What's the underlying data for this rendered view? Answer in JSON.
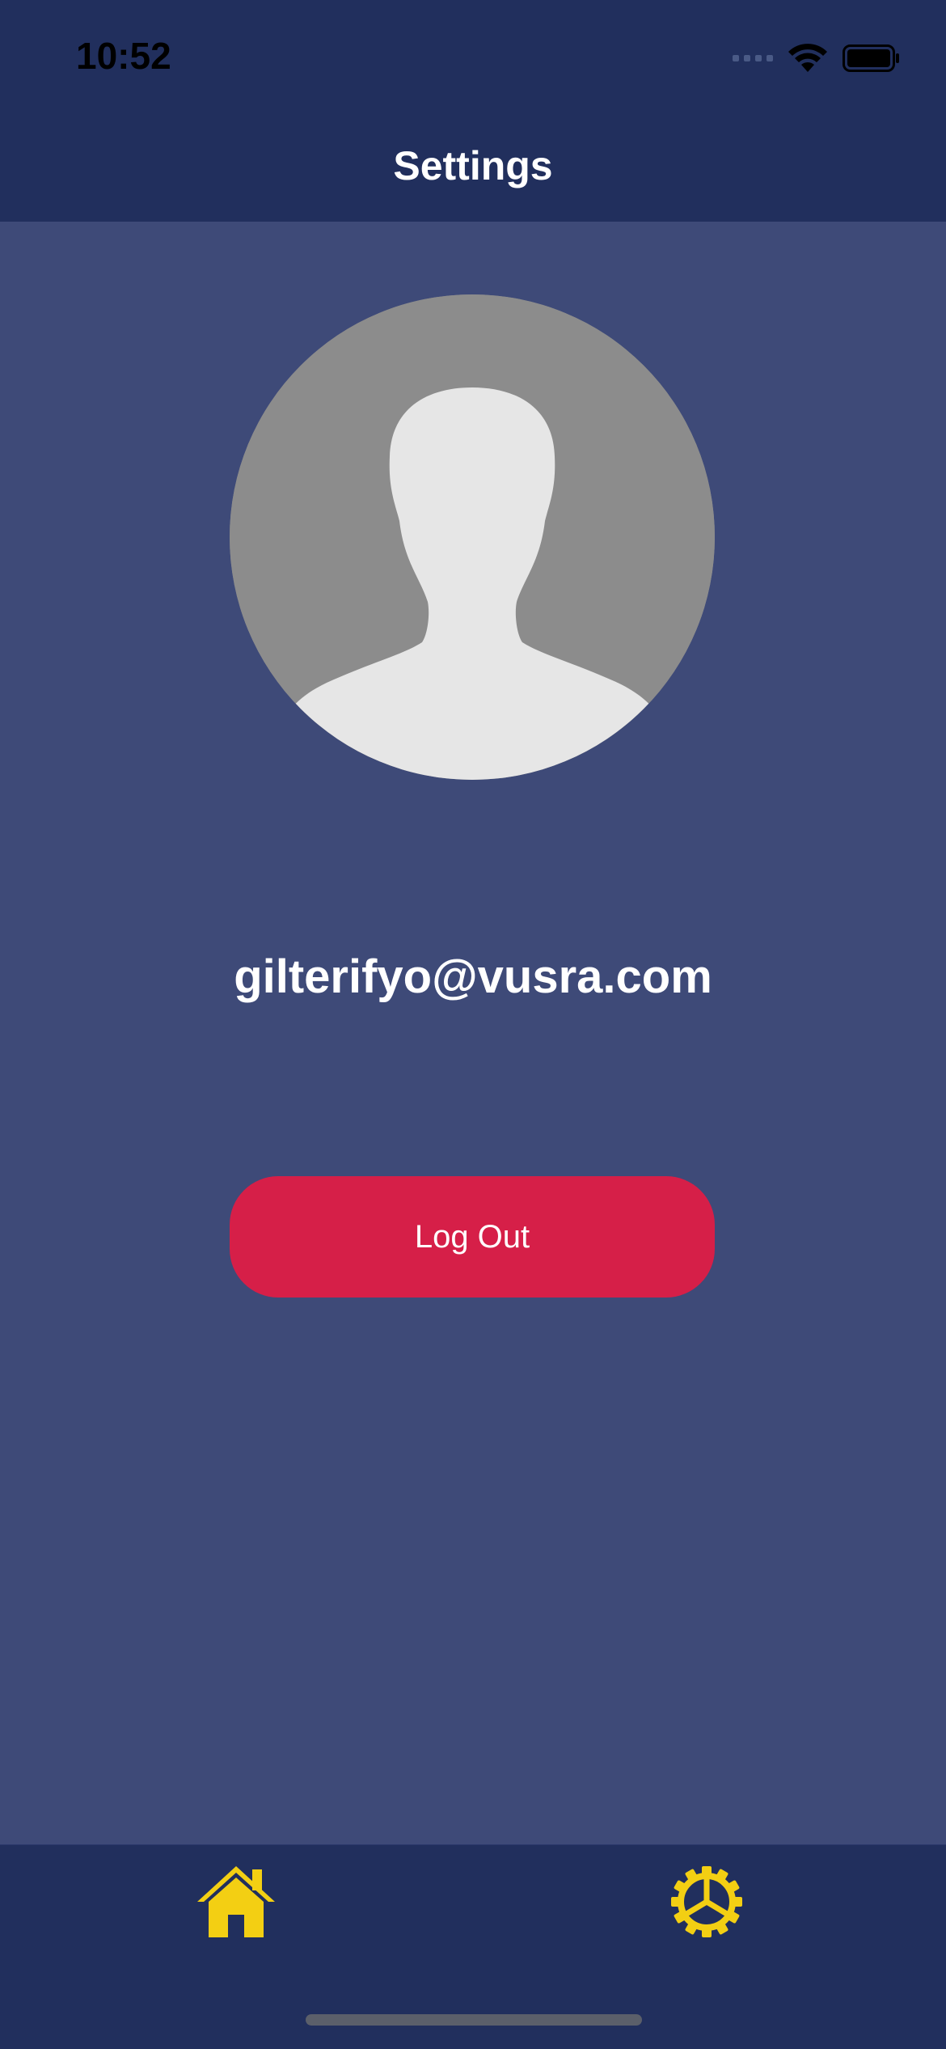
{
  "status_bar": {
    "time": "10:52",
    "icons": [
      "cellular-signal-icon",
      "wifi-icon",
      "battery-icon"
    ]
  },
  "header": {
    "title": "Settings"
  },
  "profile": {
    "avatar_icon": "person-silhouette-icon",
    "email": "gilterifyo@vusra.com"
  },
  "actions": {
    "logout_label": "Log Out"
  },
  "tab_bar": {
    "tabs": [
      {
        "name": "home",
        "icon": "house-icon"
      },
      {
        "name": "settings",
        "icon": "gear-icon"
      }
    ]
  },
  "colors": {
    "nav_background": "#212f5d",
    "content_background": "#3e4a78",
    "logout_button": "#d61f48",
    "tab_icon": "#f3cf13",
    "text": "#ffffff"
  }
}
